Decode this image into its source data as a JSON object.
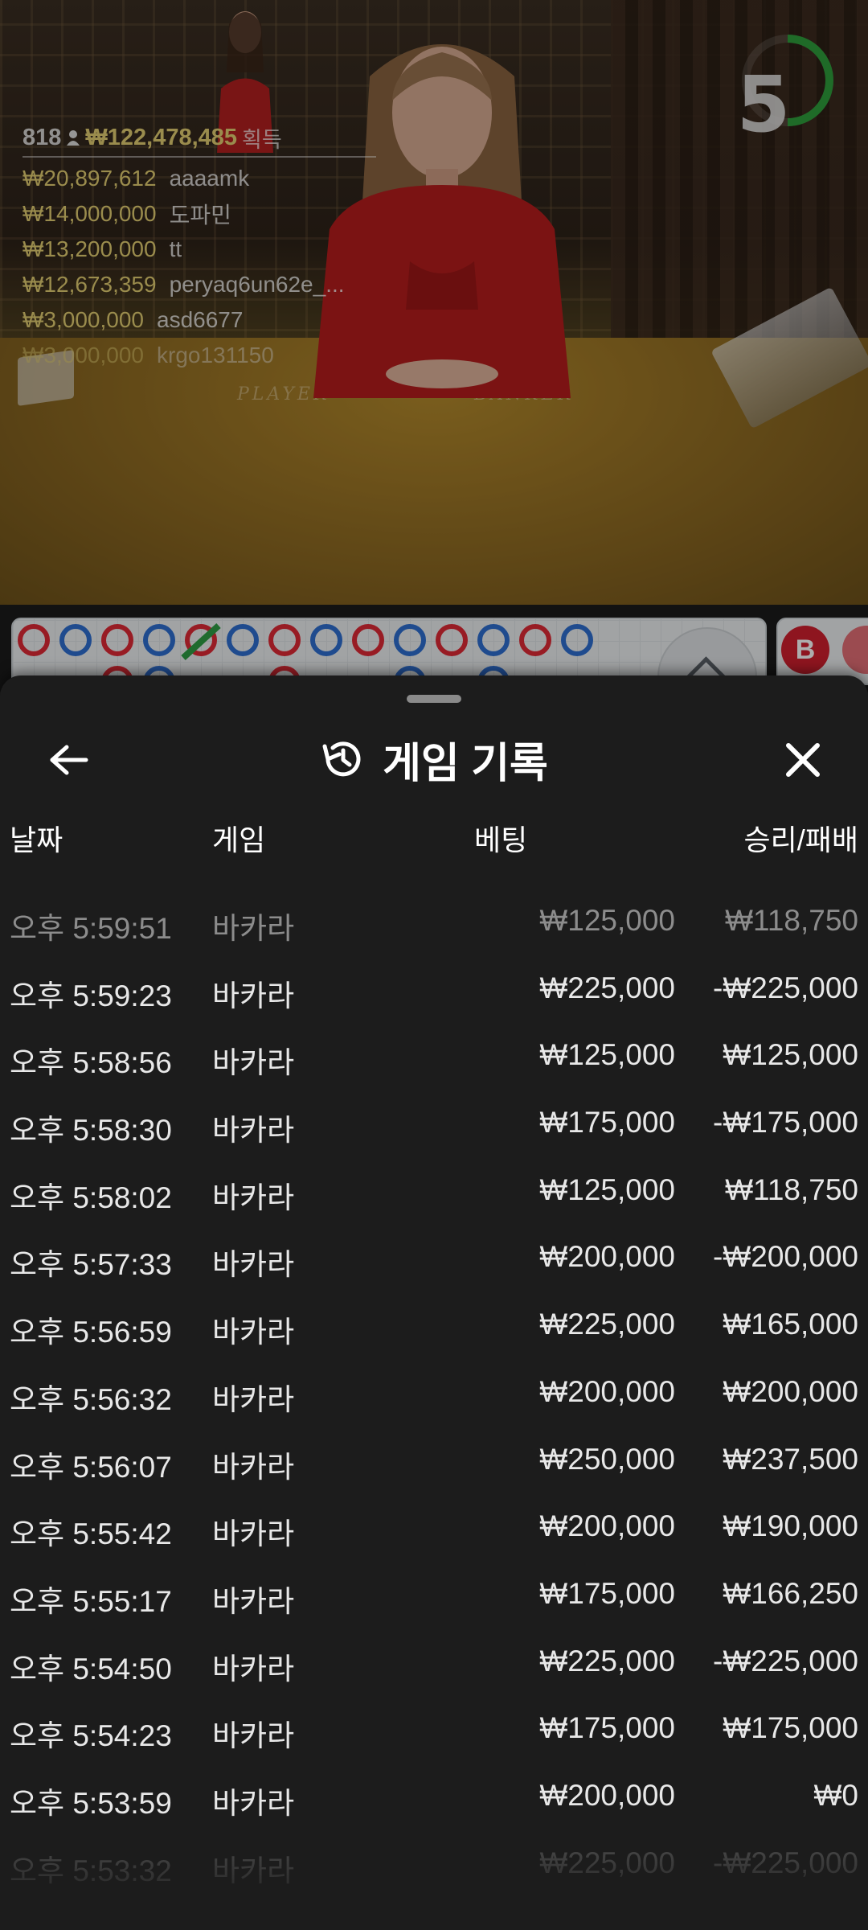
{
  "stream": {
    "countdown": "5",
    "table_labels": [
      "PLAYER",
      "BANKER"
    ],
    "bets_total": {
      "players": "818",
      "amount": "₩122,478,485",
      "label": "획득"
    },
    "bets": [
      {
        "amount": "₩20,897,612",
        "user": "aaaamk"
      },
      {
        "amount": "₩14,000,000",
        "user": "도파민"
      },
      {
        "amount": "₩13,200,000",
        "user": "tt"
      },
      {
        "amount": "₩12,673,359",
        "user": "peryaq6un62e_..."
      },
      {
        "amount": "₩3,000,000",
        "user": "asd6677"
      },
      {
        "amount": "₩3,000,000",
        "user": "krgo131150"
      }
    ]
  },
  "road": {
    "badge": "B"
  },
  "panel": {
    "title": "게임 기록",
    "back_icon": "arrow-left-icon",
    "history_icon": "history-icon",
    "close_icon": "close-icon",
    "columns": {
      "date": "날짜",
      "game": "게임",
      "bet": "베팅",
      "result": "승리/패배"
    },
    "rows": [
      {
        "time": "오후 5:59:51",
        "game": "바카라",
        "bet": "₩125,000",
        "result": "₩118,750"
      },
      {
        "time": "오후 5:59:23",
        "game": "바카라",
        "bet": "₩225,000",
        "result": "-₩225,000"
      },
      {
        "time": "오후 5:58:56",
        "game": "바카라",
        "bet": "₩125,000",
        "result": "₩125,000"
      },
      {
        "time": "오후 5:58:30",
        "game": "바카라",
        "bet": "₩175,000",
        "result": "-₩175,000"
      },
      {
        "time": "오후 5:58:02",
        "game": "바카라",
        "bet": "₩125,000",
        "result": "₩118,750"
      },
      {
        "time": "오후 5:57:33",
        "game": "바카라",
        "bet": "₩200,000",
        "result": "-₩200,000"
      },
      {
        "time": "오후 5:56:59",
        "game": "바카라",
        "bet": "₩225,000",
        "result": "₩165,000"
      },
      {
        "time": "오후 5:56:32",
        "game": "바카라",
        "bet": "₩200,000",
        "result": "₩200,000"
      },
      {
        "time": "오후 5:56:07",
        "game": "바카라",
        "bet": "₩250,000",
        "result": "₩237,500"
      },
      {
        "time": "오후 5:55:42",
        "game": "바카라",
        "bet": "₩200,000",
        "result": "₩190,000"
      },
      {
        "time": "오후 5:55:17",
        "game": "바카라",
        "bet": "₩175,000",
        "result": "₩166,250"
      },
      {
        "time": "오후 5:54:50",
        "game": "바카라",
        "bet": "₩225,000",
        "result": "-₩225,000"
      },
      {
        "time": "오후 5:54:23",
        "game": "바카라",
        "bet": "₩175,000",
        "result": "₩175,000"
      },
      {
        "time": "오후 5:53:59",
        "game": "바카라",
        "bet": "₩200,000",
        "result": "₩0"
      },
      {
        "time": "오후 5:53:32",
        "game": "바카라",
        "bet": "₩225,000",
        "result": "-₩225,000"
      }
    ]
  }
}
